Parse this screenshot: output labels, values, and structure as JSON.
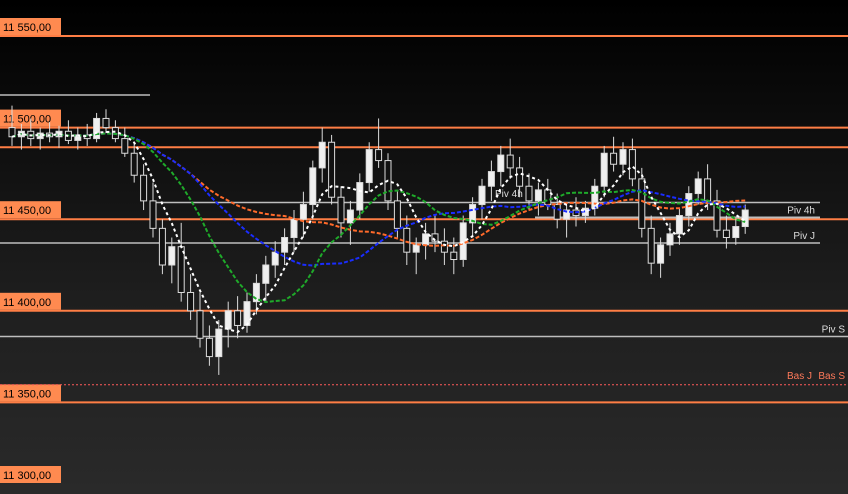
{
  "chart_data": {
    "type": "candlestick",
    "y_axis": {
      "range": [
        11300,
        11560
      ],
      "ticks": [
        "11 550,00",
        "11 500,00",
        "11 450,00",
        "11 400,00",
        "11 350,00",
        "11 300,00"
      ],
      "tick_values": [
        11550,
        11500,
        11450,
        11400,
        11350,
        11300
      ]
    },
    "grid": true,
    "colors": {
      "grid_line": "#ff7e45",
      "label_bg": "#ff8a50",
      "pivot_line": "#bdbdbd",
      "candle": "#dcdcdc",
      "ma_orange": "#ff6a2a",
      "ma_blue": "#1a2dff",
      "ma_green": "#1faa2a",
      "ma_white": "#ffffff",
      "bas": "#ff5a5a"
    },
    "levels": [
      {
        "label": "Piv 4h",
        "value": 11451.5,
        "color": "#bdbdbd"
      },
      {
        "label": "Piv J",
        "value": 11437,
        "color": "#bdbdbd"
      },
      {
        "label": "Piv S",
        "value": 11386,
        "color": "#bdbdbd"
      },
      {
        "label": "Bas J",
        "value": 11364,
        "color": "#ff5a5a"
      },
      {
        "label": "Bas S",
        "value": 11364,
        "color": "#ff5a5a"
      }
    ],
    "upper_level": 11515.5,
    "partial_label": "Piv 4h",
    "candles": [
      [
        11500,
        11512,
        11490,
        11495
      ],
      [
        11495,
        11502,
        11488,
        11498
      ],
      [
        11498,
        11505,
        11490,
        11494
      ],
      [
        11494,
        11500,
        11488,
        11497
      ],
      [
        11497,
        11503,
        11492,
        11495
      ],
      [
        11495,
        11501,
        11489,
        11498
      ],
      [
        11498,
        11504,
        11491,
        11493
      ],
      [
        11493,
        11500,
        11488,
        11496
      ],
      [
        11496,
        11502,
        11490,
        11494
      ],
      [
        11494,
        11508,
        11492,
        11505
      ],
      [
        11505,
        11510,
        11497,
        11500
      ],
      [
        11500,
        11504,
        11492,
        11494
      ],
      [
        11494,
        11500,
        11484,
        11486
      ],
      [
        11486,
        11492,
        11470,
        11474
      ],
      [
        11474,
        11480,
        11455,
        11460
      ],
      [
        11460,
        11470,
        11440,
        11445
      ],
      [
        11445,
        11450,
        11420,
        11425
      ],
      [
        11425,
        11440,
        11415,
        11435
      ],
      [
        11435,
        11448,
        11405,
        11410
      ],
      [
        11410,
        11420,
        11395,
        11400
      ],
      [
        11400,
        11410,
        11380,
        11385
      ],
      [
        11385,
        11392,
        11370,
        11375
      ],
      [
        11375,
        11395,
        11365,
        11390
      ],
      [
        11390,
        11405,
        11380,
        11400
      ],
      [
        11400,
        11408,
        11385,
        11392
      ],
      [
        11392,
        11410,
        11388,
        11405
      ],
      [
        11405,
        11420,
        11398,
        11415
      ],
      [
        11415,
        11430,
        11405,
        11425
      ],
      [
        11425,
        11438,
        11418,
        11432
      ],
      [
        11432,
        11445,
        11425,
        11440
      ],
      [
        11440,
        11455,
        11432,
        11450
      ],
      [
        11450,
        11465,
        11440,
        11458
      ],
      [
        11458,
        11482,
        11450,
        11478
      ],
      [
        11478,
        11500,
        11470,
        11492
      ],
      [
        11492,
        11496,
        11458,
        11462
      ],
      [
        11462,
        11468,
        11440,
        11448
      ],
      [
        11448,
        11460,
        11436,
        11455
      ],
      [
        11455,
        11475,
        11450,
        11470
      ],
      [
        11470,
        11492,
        11465,
        11488
      ],
      [
        11488,
        11505,
        11478,
        11482
      ],
      [
        11482,
        11486,
        11455,
        11460
      ],
      [
        11460,
        11466,
        11440,
        11445
      ],
      [
        11445,
        11452,
        11425,
        11432
      ],
      [
        11432,
        11440,
        11420,
        11436
      ],
      [
        11436,
        11448,
        11428,
        11442
      ],
      [
        11442,
        11452,
        11432,
        11438
      ],
      [
        11438,
        11445,
        11425,
        11432
      ],
      [
        11432,
        11440,
        11420,
        11428
      ],
      [
        11428,
        11452,
        11424,
        11448
      ],
      [
        11448,
        11462,
        11440,
        11458
      ],
      [
        11458,
        11472,
        11450,
        11468
      ],
      [
        11468,
        11482,
        11460,
        11476
      ],
      [
        11476,
        11490,
        11468,
        11485
      ],
      [
        11485,
        11494,
        11472,
        11478
      ],
      [
        11478,
        11484,
        11462,
        11468
      ],
      [
        11468,
        11475,
        11455,
        11460
      ],
      [
        11460,
        11470,
        11452,
        11466
      ],
      [
        11466,
        11472,
        11455,
        11458
      ],
      [
        11458,
        11464,
        11445,
        11450
      ],
      [
        11450,
        11458,
        11440,
        11455
      ],
      [
        11455,
        11462,
        11446,
        11452
      ],
      [
        11452,
        11460,
        11448,
        11456
      ],
      [
        11456,
        11472,
        11452,
        11468
      ],
      [
        11468,
        11490,
        11462,
        11486
      ],
      [
        11486,
        11495,
        11476,
        11480
      ],
      [
        11480,
        11492,
        11474,
        11488
      ],
      [
        11488,
        11494,
        11468,
        11472
      ],
      [
        11472,
        11478,
        11440,
        11445
      ],
      [
        11445,
        11452,
        11420,
        11426
      ],
      [
        11426,
        11440,
        11418,
        11436
      ],
      [
        11436,
        11448,
        11430,
        11442
      ],
      [
        11442,
        11456,
        11436,
        11452
      ],
      [
        11452,
        11468,
        11446,
        11464
      ],
      [
        11464,
        11476,
        11458,
        11472
      ],
      [
        11472,
        11480,
        11455,
        11460
      ],
      [
        11460,
        11466,
        11440,
        11444
      ],
      [
        11444,
        11452,
        11434,
        11440
      ],
      [
        11440,
        11450,
        11436,
        11446
      ],
      [
        11446,
        11458,
        11442,
        11455
      ]
    ]
  }
}
